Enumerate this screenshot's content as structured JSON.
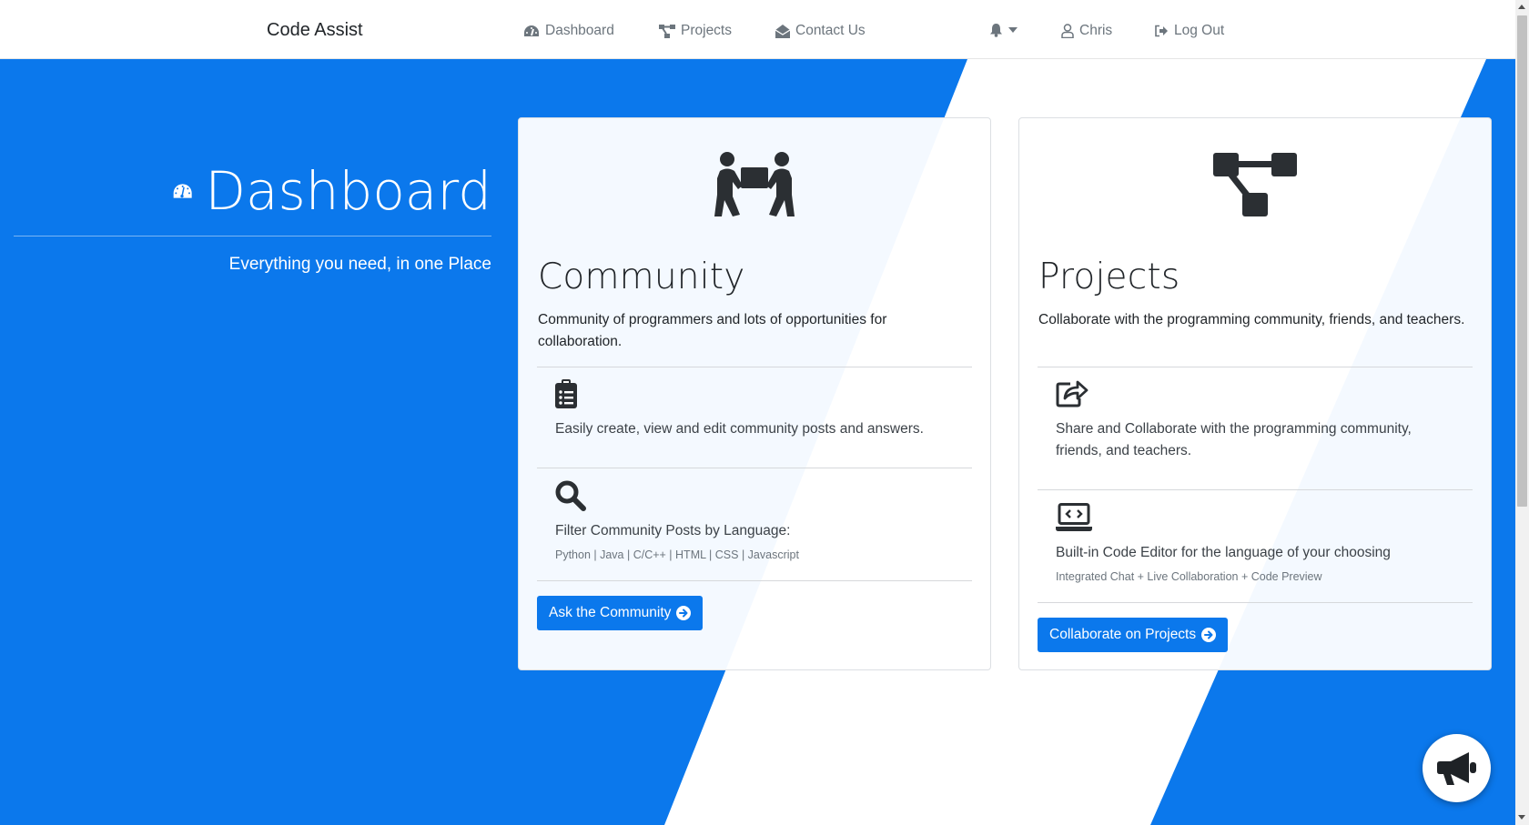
{
  "navbar": {
    "brand": "Code Assist",
    "links": {
      "dashboard": "Dashboard",
      "projects": "Projects",
      "contact": "Contact Us",
      "user": "Chris",
      "logout": "Log Out"
    },
    "icons": {
      "dashboard": "tachometer-icon",
      "projects": "sitemap-icon",
      "contact": "envelope-open-icon",
      "notifications": "bell-icon",
      "user": "user-icon",
      "logout": "sign-out-icon"
    }
  },
  "hero": {
    "title": "Dashboard",
    "subtitle": "Everything you need, in one Place",
    "icon": "tachometer-icon"
  },
  "community": {
    "title": "Community",
    "description": "Community of programmers and lots of opportunities for collaboration.",
    "icon": "people-carry-icon",
    "feature1": {
      "icon": "clipboard-list-icon",
      "text": "Easily create, view and edit community posts and answers."
    },
    "feature2": {
      "icon": "search-icon",
      "text": "Filter Community Posts by Language:",
      "languages": "Python | Java | C/C++ | HTML | CSS | Javascript"
    },
    "button": "Ask the Community",
    "button_icon": "arrow-circle-right-icon"
  },
  "projects": {
    "title": "Projects",
    "description": "Collaborate with the programming community, friends, and teachers.",
    "icon": "project-diagram-icon",
    "feature1": {
      "icon": "share-square-icon",
      "text": "Share and Collaborate with the programming community, friends, and teachers."
    },
    "feature2": {
      "icon": "laptop-code-icon",
      "text": "Built-in Code Editor for the language of your choosing",
      "subtext": "Integrated Chat + Live Collaboration + Code Preview"
    },
    "button": "Collaborate on Projects",
    "button_icon": "arrow-circle-right-icon"
  },
  "fab": {
    "icon": "bullhorn-icon"
  },
  "colors": {
    "primary": "#0b78ec",
    "dark_icon": "#2b2f33",
    "nav_text": "#6c757d"
  }
}
